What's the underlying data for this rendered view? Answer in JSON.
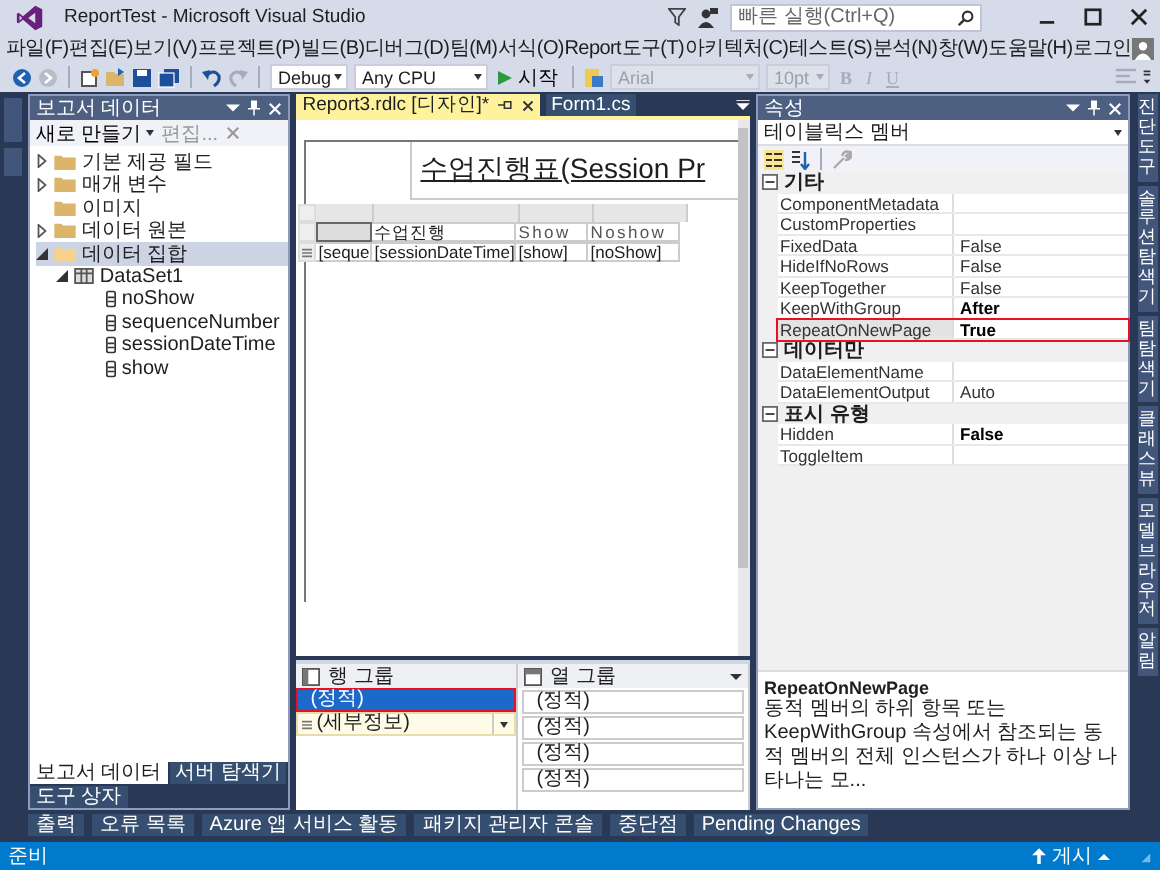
{
  "window": {
    "title": "ReportTest - Microsoft Visual Studio"
  },
  "quick_launch": {
    "placeholder": "빠른 실행(Ctrl+Q)"
  },
  "menu": [
    "파일(F)",
    "편집(E)",
    "보기(V)",
    "프로젝트(P)",
    "빌드(B)",
    "디버그(D)",
    "팀(M)",
    "서식(O)",
    "Report",
    "도구(T)",
    "아키텍처(C)",
    "테스트(S)",
    "분석(N)",
    "창(W)",
    "도움말(H)",
    "로그인"
  ],
  "toolbar": {
    "configuration": "Debug",
    "platform": "Any CPU",
    "start": "시작",
    "font": "Arial",
    "font_size": "10pt",
    "format_buttons": [
      "B",
      "I",
      "U"
    ],
    "formatting_disabled": true
  },
  "left_panel": {
    "title": "보고서 데이터",
    "new_button": "새로 만들기",
    "edit_button": "편집...",
    "tree": [
      {
        "label": "기본 제공 필드",
        "kind": "folder",
        "expanded": false,
        "selected": false
      },
      {
        "label": "매개 변수",
        "kind": "folder",
        "expanded": false,
        "selected": false
      },
      {
        "label": "이미지",
        "kind": "folder",
        "selected": false
      },
      {
        "label": "데이터 원본",
        "kind": "folder",
        "expanded": false,
        "selected": false
      },
      {
        "label": "데이터 집합",
        "kind": "folder",
        "expanded": true,
        "selected": true,
        "children": [
          {
            "label": "DataSet1",
            "kind": "dataset",
            "expanded": true,
            "selected": false,
            "children": [
              {
                "label": "noShow",
                "kind": "field",
                "selected": false
              },
              {
                "label": "sequenceNumber",
                "kind": "field",
                "selected": false
              },
              {
                "label": "sessionDateTime",
                "kind": "field",
                "selected": false
              },
              {
                "label": "show",
                "kind": "field",
                "selected": false
              }
            ]
          }
        ]
      }
    ],
    "tabs": [
      {
        "label": "보고서 데이터",
        "selected": true
      },
      {
        "label": "서버 탐색기",
        "selected": false
      },
      {
        "label": "도구 상자",
        "selected": false
      }
    ]
  },
  "document_tabs": [
    {
      "label": "Report3.rdlc [디자인]*",
      "selected": true
    },
    {
      "label": "Form1.cs",
      "selected": false
    }
  ],
  "report": {
    "title": "수업진행표(Session Pr",
    "header_row": [
      "수업진행",
      "Show",
      "Noshow"
    ],
    "data_row": [
      "[seque",
      "[sessionDateTime]",
      "[show]",
      "[noShow]"
    ]
  },
  "row_groups": {
    "title": "행 그룹",
    "items": [
      {
        "label": "(정적)",
        "kind": "static",
        "selected": true
      },
      {
        "label": "(세부정보)",
        "kind": "details",
        "selected": false
      }
    ]
  },
  "column_groups": {
    "title": "열 그룹",
    "items": [
      "(정적)",
      "(정적)",
      "(정적)",
      "(정적)"
    ]
  },
  "properties": {
    "title": "속성",
    "object": "테이블릭스 멤버",
    "categories": [
      {
        "name": "기타",
        "expanded": true,
        "items": [
          {
            "name": "ComponentMetadata",
            "selected": false
          },
          {
            "name": "CustomProperties",
            "selected": false
          },
          {
            "name": "FixedData",
            "value": "False",
            "modified": false,
            "selected": false
          },
          {
            "name": "HideIfNoRows",
            "value": "False",
            "modified": false,
            "selected": false
          },
          {
            "name": "KeepTogether",
            "value": "False",
            "modified": false,
            "selected": false
          },
          {
            "name": "KeepWithGroup",
            "value": "After",
            "modified": true,
            "selected": false
          },
          {
            "name": "RepeatOnNewPage",
            "value": "True",
            "modified": true,
            "selected": true
          }
        ]
      },
      {
        "name": "데이터만",
        "expanded": true,
        "items": [
          {
            "name": "DataElementName",
            "selected": false
          },
          {
            "name": "DataElementOutput",
            "value": "Auto",
            "modified": false,
            "selected": false
          }
        ]
      },
      {
        "name": "표시 유형",
        "expanded": true,
        "items": [
          {
            "name": "Hidden",
            "value": "False",
            "modified": true,
            "selected": false
          },
          {
            "name": "ToggleItem",
            "selected": false
          }
        ]
      }
    ],
    "description": {
      "title": "RepeatOnNewPage",
      "text": "동적 멤버의 하위 항목 또는 KeepWithGroup 속성에서 참조되는 동적 멤버의 전체 인스턴스가 하나 이상 나타나는 모..."
    }
  },
  "right_tabs": [
    "진단 도구",
    "솔루션 탐색기",
    "팀 탐색기",
    "클래스 뷰",
    "모델 브라우저",
    "알림"
  ],
  "bottom_tabs": [
    "출력",
    "오류 목록",
    "Azure 앱 서비스 활동",
    "패키지 관리자 콘솔",
    "중단점",
    "Pending Changes"
  ],
  "status_bar": {
    "text": "준비",
    "publish": "게시"
  }
}
